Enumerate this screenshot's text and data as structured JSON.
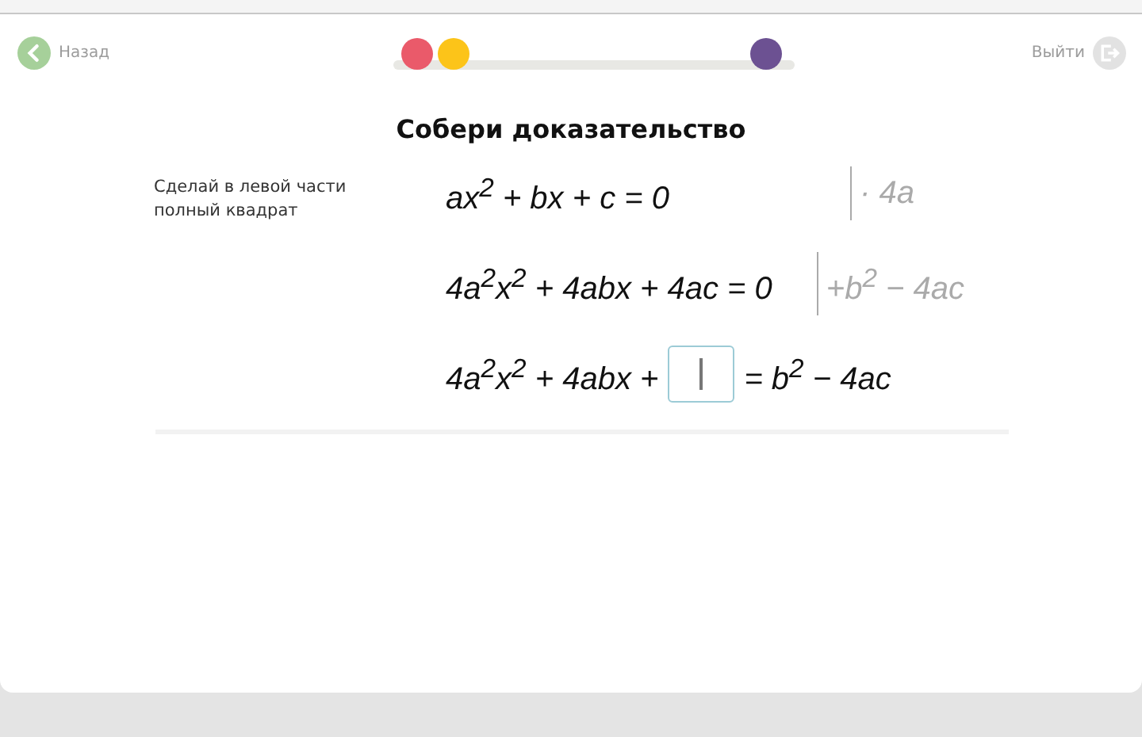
{
  "header": {
    "back": "Назад",
    "exit": "Выйти"
  },
  "progress": {
    "dots": [
      {
        "color": "#ea5a6a",
        "level": 0.06
      },
      {
        "color": "#fcc419",
        "level": 0.15
      },
      {
        "color": "#6c5192",
        "level": 0.93
      }
    ]
  },
  "title": "Собери доказательство",
  "hint": "Сделай в левой части полный квадрат",
  "rows": [
    {
      "kind": "equation",
      "expr": "ax$^{2}$ + bx + c = 0",
      "note": "· 4a"
    },
    {
      "kind": "equation",
      "expr": "4a$^{2}$x$^{2}$ + 4abx + 4ac = 0",
      "note": "+b$^{2}$ − 4ac"
    },
    {
      "kind": "blank",
      "left": "4a$^{2}$x$^{2}$ + 4abx +",
      "right": "= b$^{2}$ − 4ac",
      "field": {
        "focused": true
      }
    }
  ]
}
